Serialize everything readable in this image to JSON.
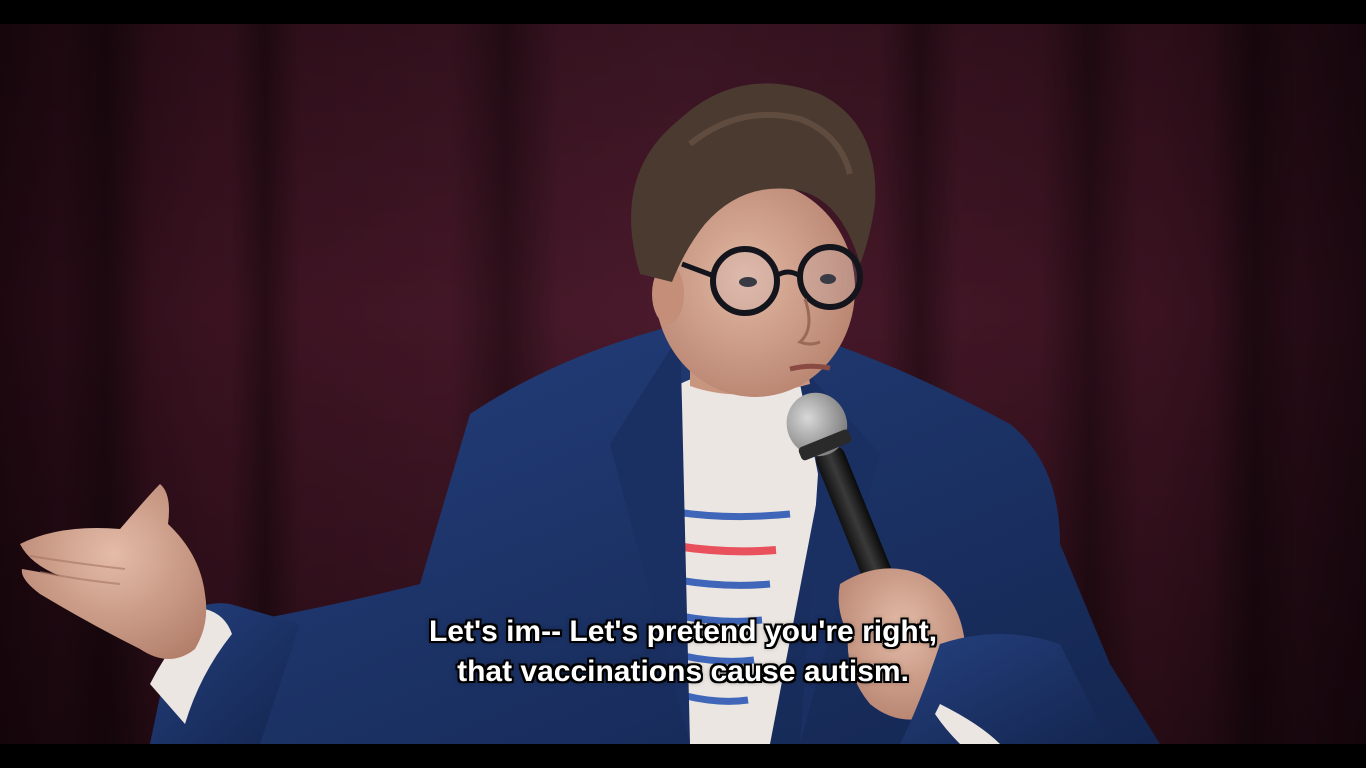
{
  "subtitles": {
    "line1": "Let's im-- Let's pretend you're right,",
    "line2": "that vaccinations cause autism."
  },
  "colors": {
    "curtain": "#3a1220",
    "blazer": "#1c3266",
    "shirt": "#ece6e2",
    "stripe_blue": "#3f66b8",
    "stripe_red": "#e8505c",
    "subtitle_text": "#ffffff"
  }
}
